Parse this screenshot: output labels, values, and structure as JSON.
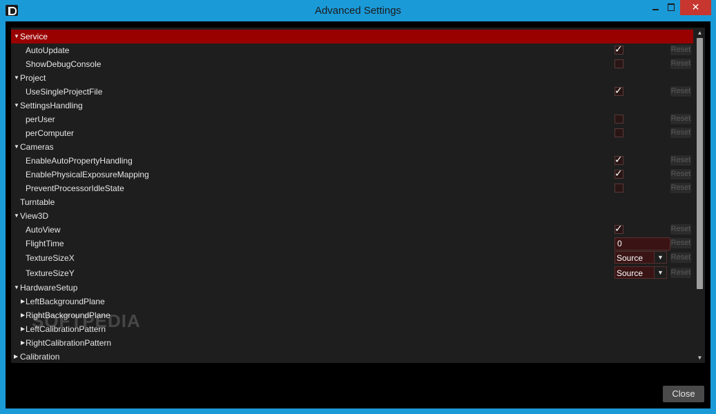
{
  "window": {
    "title": "Advanced Settings",
    "min_glyph": "",
    "close_glyph": "✕"
  },
  "colors": {
    "selected_row": "#990000",
    "panel_bg": "#1e1e1e",
    "titlebar": "#1b9ad8"
  },
  "sections": [
    {
      "key": "service",
      "label": "Service",
      "expanded": true,
      "selected": true,
      "icon": "triangle-down"
    },
    {
      "key": "project",
      "label": "Project",
      "expanded": true
    },
    {
      "key": "settingshandling",
      "label": "SettingsHandling",
      "expanded": true
    },
    {
      "key": "cameras",
      "label": "Cameras",
      "expanded": true
    },
    {
      "key": "turntable",
      "label": "Turntable",
      "expanded": false
    },
    {
      "key": "view3d",
      "label": "View3D",
      "expanded": true
    },
    {
      "key": "hardwaresetup",
      "label": "HardwareSetup",
      "expanded": true
    },
    {
      "key": "calibration",
      "label": "Calibration",
      "expanded": false
    }
  ],
  "items": {
    "autoupdate": {
      "label": "AutoUpdate",
      "checked": true,
      "reset": "Reset"
    },
    "showdebugconsole": {
      "label": "ShowDebugConsole",
      "checked": false,
      "reset": "Reset"
    },
    "usesingleprojectfile": {
      "label": "UseSingleProjectFile",
      "checked": true,
      "reset": "Reset"
    },
    "peruser": {
      "label": "perUser",
      "checked": false,
      "reset": "Reset"
    },
    "percomputer": {
      "label": "perComputer",
      "checked": false,
      "reset": "Reset"
    },
    "enableautopropertyhandling": {
      "label": "EnableAutoPropertyHandling",
      "checked": true,
      "reset": "Reset"
    },
    "enablephysicalexposuremapping": {
      "label": "EnablePhysicalExposureMapping",
      "checked": true,
      "reset": "Reset"
    },
    "preventprocessoridlestate": {
      "label": "PreventProcessorIdleState",
      "checked": false,
      "reset": "Reset"
    },
    "autoview": {
      "label": "AutoView",
      "checked": true,
      "reset": "Reset"
    },
    "flighttime": {
      "label": "FlightTime",
      "value": "0",
      "reset": "Reset"
    },
    "texturesizex": {
      "label": "TextureSizeX",
      "value": "Source",
      "reset": "Reset"
    },
    "texturesizey": {
      "label": "TextureSizeY",
      "value": "Source",
      "reset": "Reset"
    }
  },
  "hardware_children": [
    {
      "label": "LeftBackgroundPlane"
    },
    {
      "label": "RightBackgroundPlane"
    },
    {
      "label": "LeftCalibrationPattern"
    },
    {
      "label": "RightCalibrationPattern"
    }
  ],
  "checkmark": "✓",
  "arrow_down": "▼",
  "arrow_right": "▶",
  "watermark": "SOFTPEDIA",
  "footer": {
    "close_label": "Close"
  }
}
